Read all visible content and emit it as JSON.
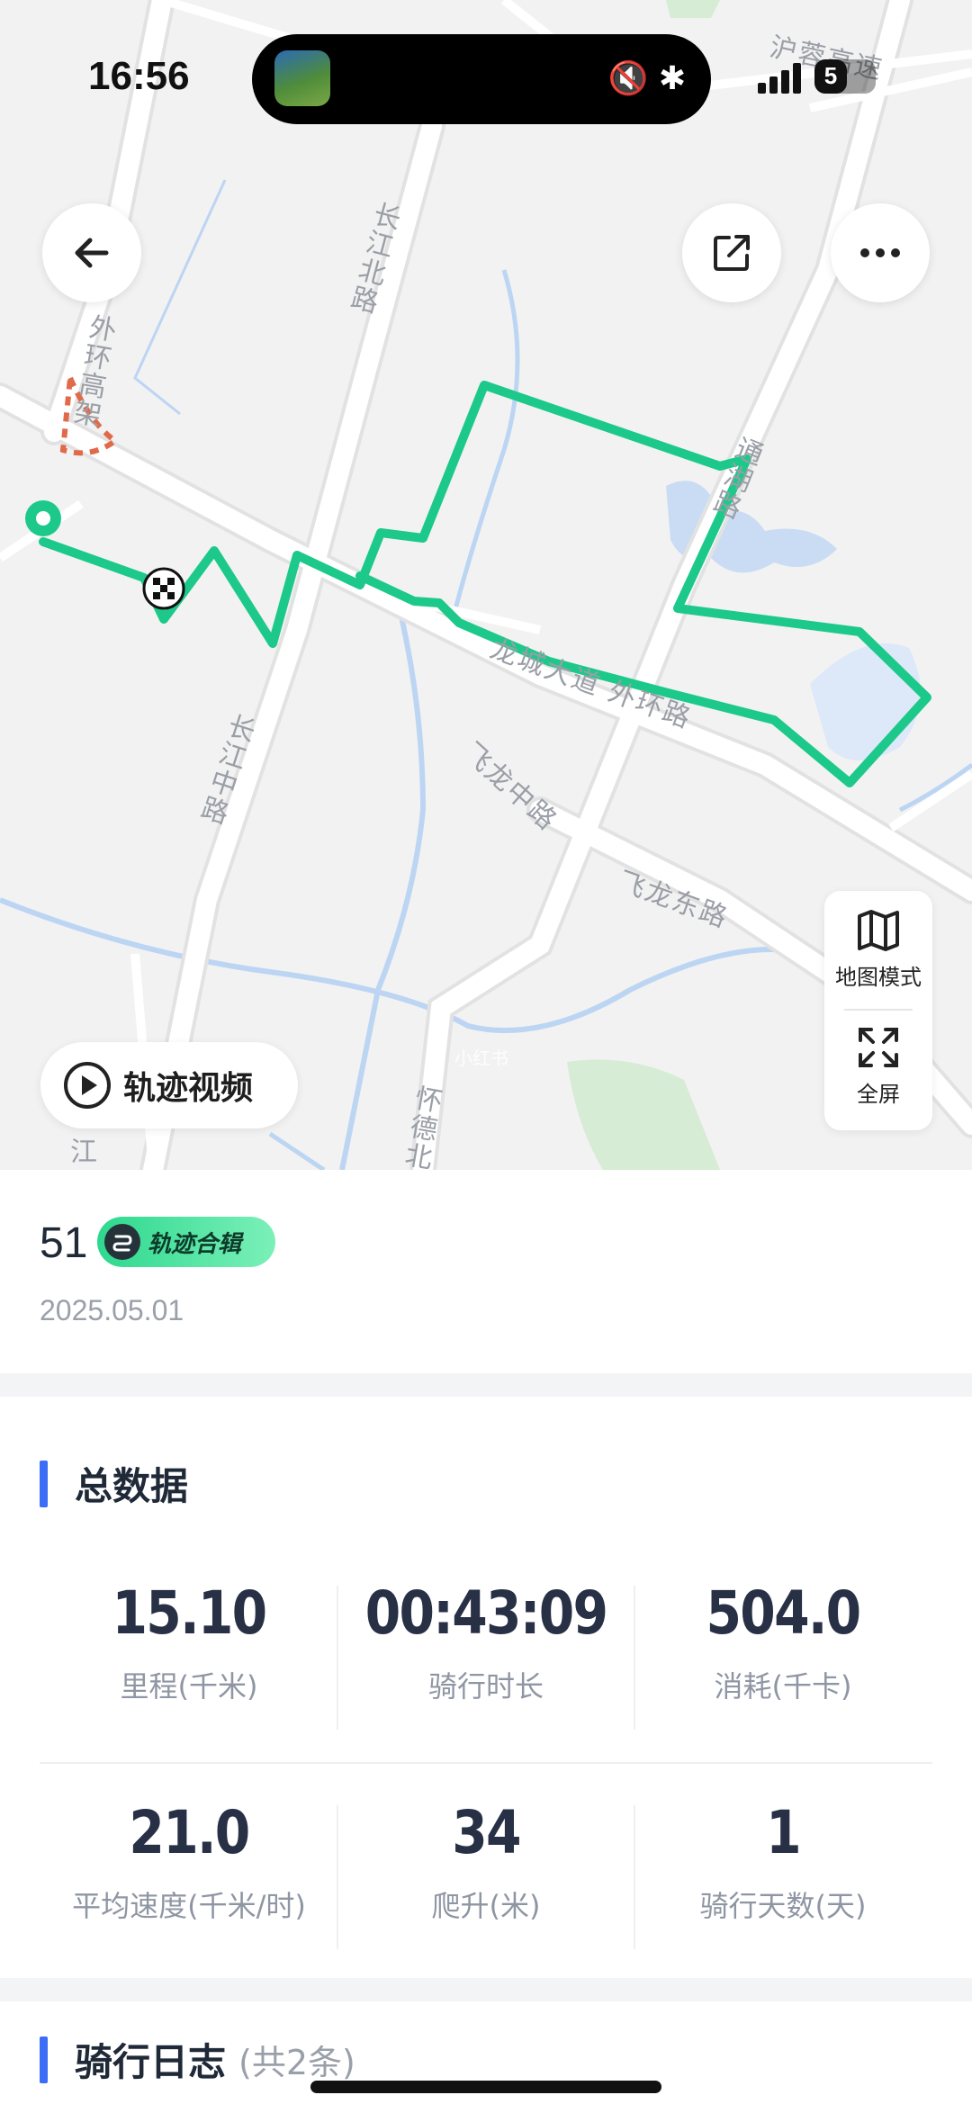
{
  "status_bar": {
    "time": "16:56",
    "battery_level": "5",
    "battery_fraction": 0.05,
    "island_icons": "🔇 ✱"
  },
  "map": {
    "road_labels": {
      "hu_rong": "沪蓉高速",
      "changjiang_north": "长江北路",
      "waihuan": "外环高架",
      "tonghu": "通湖路",
      "longcheng": "龙城大道 外环路",
      "changjiang_mid": "长江中路",
      "feilong_mid": "飞龙中路",
      "feilong_east": "飞龙东路",
      "huaide": "怀德北",
      "jiang": "江"
    },
    "watermark": "小红书",
    "route_color": "#1dc98a",
    "map_mode_label": "地图模式",
    "fullscreen_label": "全屏",
    "track_video_label": "轨迹视频"
  },
  "ride": {
    "number": "51",
    "badge_label": "轨迹合辑",
    "date": "2025.05.01"
  },
  "stats": {
    "title": "总数据",
    "items": [
      {
        "value": "15.10",
        "label": "里程(千米)"
      },
      {
        "value": "00:43:09",
        "label": "骑行时长"
      },
      {
        "value": "504.0",
        "label": "消耗(千卡)"
      },
      {
        "value": "21.0",
        "label": "平均速度(千米/时)"
      },
      {
        "value": "34",
        "label": "爬升(米)"
      },
      {
        "value": "1",
        "label": "骑行天数(天)"
      }
    ]
  },
  "log": {
    "title": "骑行日志",
    "count": "(共2条)"
  },
  "colors": {
    "accent_blue": "#3b6df6",
    "route_green": "#1dc98a",
    "badge_green": "#2ed88f"
  }
}
